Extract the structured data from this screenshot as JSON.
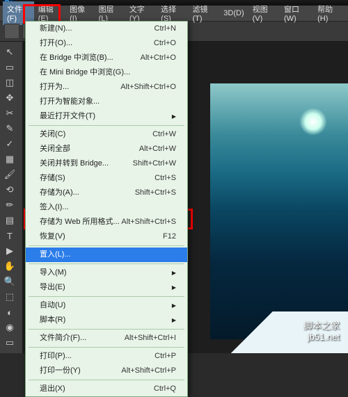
{
  "menubar": {
    "items": [
      {
        "label": "文件(F)"
      },
      {
        "label": "编辑(E)"
      },
      {
        "label": "图像(I)"
      },
      {
        "label": "图层(L)"
      },
      {
        "label": "文字(Y)"
      },
      {
        "label": "选择(S)"
      },
      {
        "label": "滤镜(T)"
      },
      {
        "label": "3D(D)"
      },
      {
        "label": "视图(V)"
      },
      {
        "label": "窗口(W)"
      },
      {
        "label": "帮助(H)"
      }
    ]
  },
  "dropdown": [
    {
      "label": "新建(N)...",
      "shortcut": "Ctrl+N"
    },
    {
      "label": "打开(O)...",
      "shortcut": "Ctrl+O"
    },
    {
      "label": "在 Bridge 中浏览(B)...",
      "shortcut": "Alt+Ctrl+O"
    },
    {
      "label": "在 Mini Bridge 中浏览(G)...",
      "shortcut": ""
    },
    {
      "label": "打开为...",
      "shortcut": "Alt+Shift+Ctrl+O"
    },
    {
      "label": "打开为智能对象...",
      "shortcut": ""
    },
    {
      "label": "最近打开文件(T)",
      "shortcut": "",
      "sub": true
    },
    {
      "sep": true
    },
    {
      "label": "关闭(C)",
      "shortcut": "Ctrl+W"
    },
    {
      "label": "关闭全部",
      "shortcut": "Alt+Ctrl+W"
    },
    {
      "label": "关闭并转到 Bridge...",
      "shortcut": "Shift+Ctrl+W"
    },
    {
      "label": "存储(S)",
      "shortcut": "Ctrl+S"
    },
    {
      "label": "存储为(A)...",
      "shortcut": "Shift+Ctrl+S"
    },
    {
      "label": "签入(I)...",
      "shortcut": ""
    },
    {
      "label": "存储为 Web 所用格式...",
      "shortcut": "Alt+Shift+Ctrl+S"
    },
    {
      "label": "恢复(V)",
      "shortcut": "F12"
    },
    {
      "sep": true
    },
    {
      "label": "置入(L)...",
      "shortcut": "",
      "highlight": true
    },
    {
      "sep": true
    },
    {
      "label": "导入(M)",
      "shortcut": "",
      "sub": true
    },
    {
      "label": "导出(E)",
      "shortcut": "",
      "sub": true
    },
    {
      "sep": true
    },
    {
      "label": "自动(U)",
      "shortcut": "",
      "sub": true
    },
    {
      "label": "脚本(R)",
      "shortcut": "",
      "sub": true
    },
    {
      "sep": true
    },
    {
      "label": "文件简介(F)...",
      "shortcut": "Alt+Shift+Ctrl+I"
    },
    {
      "sep": true
    },
    {
      "label": "打印(P)...",
      "shortcut": "Ctrl+P"
    },
    {
      "label": "打印一份(Y)",
      "shortcut": "Alt+Shift+Ctrl+P"
    },
    {
      "sep": true
    },
    {
      "label": "退出(X)",
      "shortcut": "Ctrl+Q"
    }
  ],
  "tools": [
    "↖",
    "▭",
    "◫",
    "✥",
    "✂",
    "✎",
    "✓",
    "▦",
    "🖌",
    "⟲",
    "✏",
    "▤",
    "T",
    "▶",
    "✋",
    "🔍",
    "⬚",
    "◐",
    "◉",
    "▭"
  ],
  "watermark": {
    "line1": "脚本之家",
    "line2": "jb51.net"
  }
}
